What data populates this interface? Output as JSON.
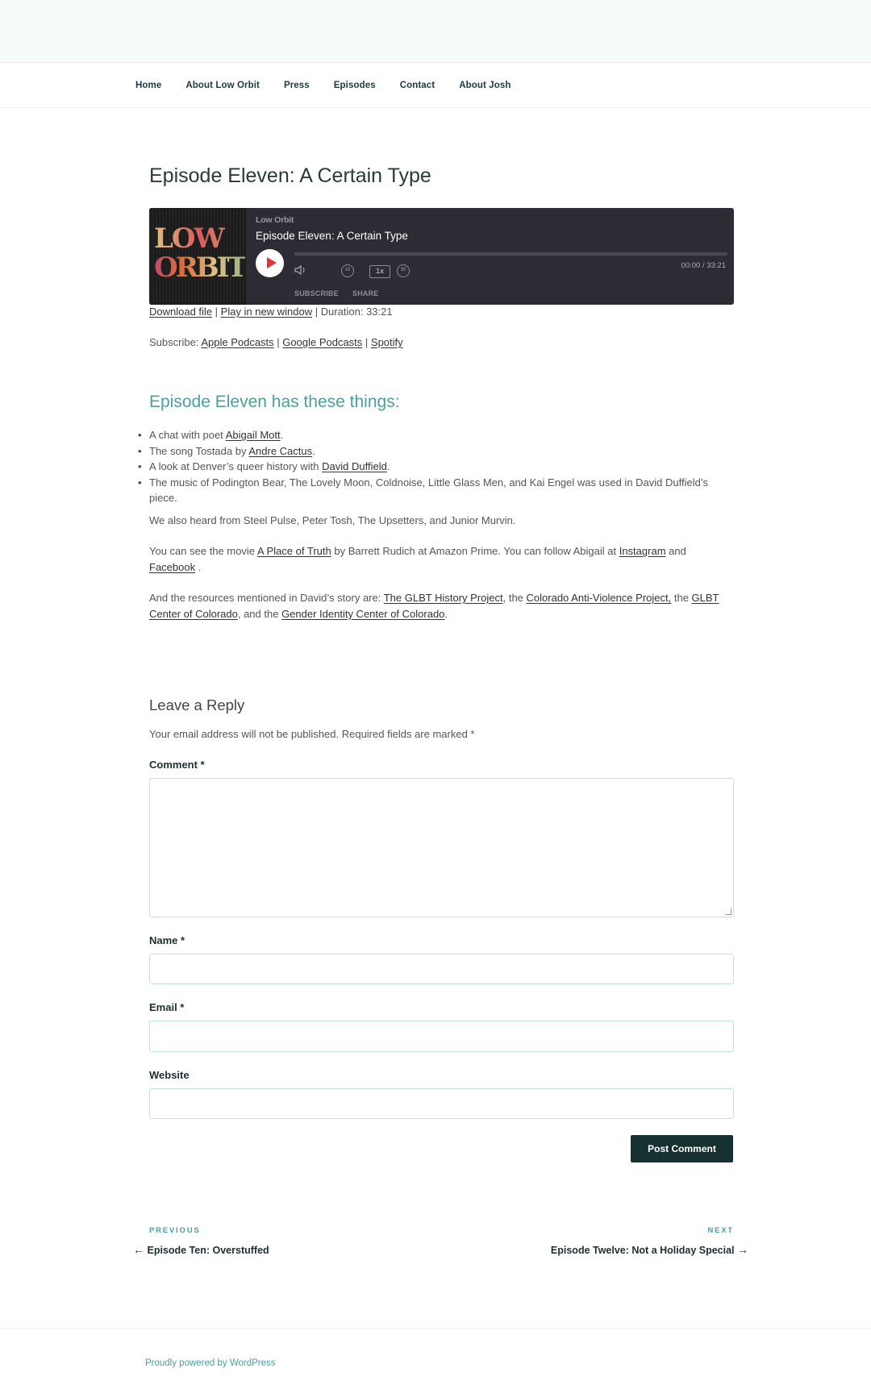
{
  "nav": {
    "items": [
      {
        "label": "Home"
      },
      {
        "label": "About Low Orbit"
      },
      {
        "label": "Press"
      },
      {
        "label": "Episodes"
      },
      {
        "label": "Contact"
      },
      {
        "label": "About Josh"
      }
    ]
  },
  "post": {
    "title": "Episode Eleven: A Certain Type"
  },
  "player": {
    "show": "Low Orbit",
    "episode": "Episode Eleven: A Certain Type",
    "cover_line1": "LOW",
    "cover_line2": "ORBIT",
    "time": "00:00 / 33:21",
    "back_label": "10",
    "speed": "1x",
    "fwd_label": "30",
    "subscribe": "SUBSCRIBE",
    "share": "SHARE"
  },
  "meta": {
    "download": "Download file",
    "sep1": " | ",
    "play_new": "Play in new window",
    "duration": " | Duration: 33:21"
  },
  "subscribe": {
    "prefix": "Subscribe: ",
    "apple": "Apple Podcasts",
    "sep1": " | ",
    "google": "Google Podcasts",
    "sep2": " | ",
    "spotify": "Spotify"
  },
  "body": {
    "subheading": "Episode Eleven has these things:",
    "item1_pre": "A chat with poet ",
    "item1_link": "Abigail Mott",
    "item1_post": ".",
    "item2_pre": "The song Tostada by ",
    "item2_link": "Andre Cactus",
    "item2_post": ".",
    "item3_pre": "A look at Denver’s queer history with ",
    "item3_link": "David Duffield",
    "item3_post": ".",
    "item4": "The music of Podington Bear, The Lovely Moon, Coldnoise, Little Glass Men, and Kai Engel was used in David Duffield’s piece.",
    "para1": "We also heard from Steel Pulse, Peter Tosh, The Upsetters, and Junior Murvin.",
    "para2_a": "You can see the movie ",
    "para2_link1": "A Place of Truth",
    "para2_b": " by Barrett Rudich at Amazon Prime. You can follow Abigail at ",
    "para2_link2": "Instagram",
    "para2_c": " and ",
    "para2_link3": "Facebook",
    "para2_d": " .",
    "para3_a": "And the resources mentioned in David’s story are: ",
    "para3_link1": "The GLBT History Project",
    "para3_b": ", the ",
    "para3_link2": "Colorado Anti-Violence Project,",
    "para3_c": " the ",
    "para3_link3": "GLBT Center of Colorado",
    "para3_d": ", and the ",
    "para3_link4": "Gender Identity Center of Colorado",
    "para3_e": "."
  },
  "reply": {
    "title": "Leave a Reply",
    "note": "Your email address will not be published. Required fields are marked *",
    "comment_label": "Comment *",
    "name_label": "Name *",
    "email_label": "Email *",
    "website_label": "Website",
    "submit": "Post Comment"
  },
  "post_nav": {
    "prev_label": "PREVIOUS",
    "prev_title": "Episode Ten: Overstuffed",
    "next_label": "NEXT",
    "next_title": "Episode Twelve: Not a Holiday Special"
  },
  "footer": {
    "powered": "Proudly powered by WordPress"
  },
  "colors": {
    "accent": "#4b9f9c",
    "dark": "#16312f",
    "player_bg": "#2d2b33",
    "play": "#e0343a"
  }
}
